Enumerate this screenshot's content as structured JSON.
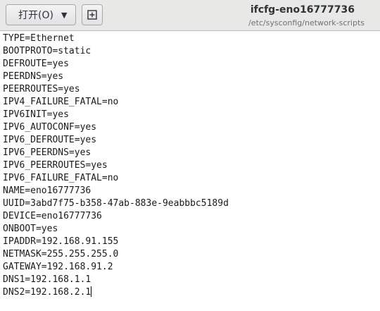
{
  "header": {
    "open_label": "打开(O)",
    "title": "ifcfg-eno16777736",
    "path": "/etc/sysconfig/network-scripts"
  },
  "icons": {
    "open_dropdown": "chevron-down-icon",
    "new_document": "new-document-icon"
  },
  "editor": {
    "lines": [
      "TYPE=Ethernet",
      "BOOTPROTO=static",
      "DEFROUTE=yes",
      "PEERDNS=yes",
      "PEERROUTES=yes",
      "IPV4_FAILURE_FATAL=no",
      "IPV6INIT=yes",
      "IPV6_AUTOCONF=yes",
      "IPV6_DEFROUTE=yes",
      "IPV6_PEERDNS=yes",
      "IPV6_PEERROUTES=yes",
      "IPV6_FAILURE_FATAL=no",
      "NAME=eno16777736",
      "UUID=3abd7f75-b358-47ab-883e-9eabbbc5189d",
      "DEVICE=eno16777736",
      "ONBOOT=yes",
      "IPADDR=192.168.91.155",
      "NETMASK=255.255.255.0",
      "GATEWAY=192.168.91.2",
      "DNS1=192.168.1.1",
      "DNS2=192.168.2.1"
    ]
  }
}
